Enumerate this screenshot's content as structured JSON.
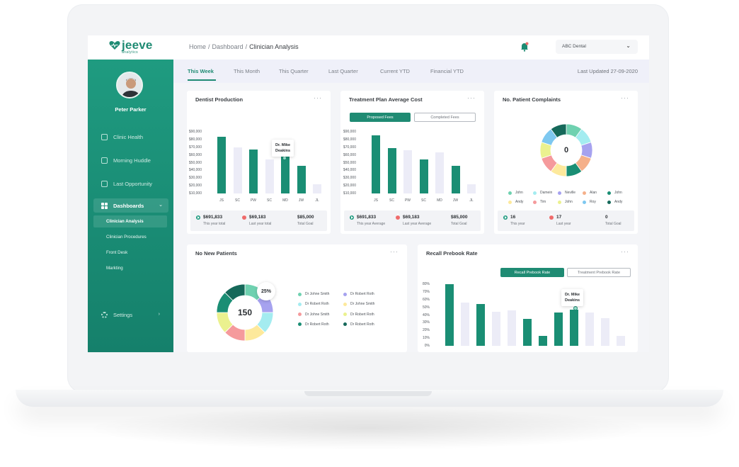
{
  "header": {
    "logo_text": "jeeve",
    "logo_sub": "analytics",
    "breadcrumb": [
      "Home",
      "/",
      "Dashboard",
      "/",
      "Clinician Analysis"
    ],
    "clinic": "ABC Dental"
  },
  "sidebar": {
    "user": "Peter Parker",
    "items": [
      {
        "label": "Clinic Health"
      },
      {
        "label": "Morning Huddle"
      },
      {
        "label": "Last Opportunity"
      }
    ],
    "dashboards_label": "Dashboards",
    "sub_items": [
      {
        "label": "Clinician Analysis"
      },
      {
        "label": "Clinician Procedures"
      },
      {
        "label": "Front Desk"
      },
      {
        "label": "Markting"
      }
    ],
    "settings_label": "Settings"
  },
  "tabs": [
    "This Week",
    "This Month",
    "This Quarter",
    "Last Quarter",
    "Current YTD",
    "Financial YTD"
  ],
  "last_updated": "Last Updated 27-09-2020",
  "colors": {
    "accent": "#1f8b73",
    "bar_primary": "#1a8e74",
    "bar_secondary": "#ececf7"
  },
  "cards": {
    "dentist_production": {
      "title": "Dentist Production",
      "more": "···",
      "tooltip": [
        "Dr. Mike",
        "Deakins"
      ],
      "stats": [
        {
          "value": "$691,833",
          "label": "This year total",
          "trend": "up"
        },
        {
          "value": "$69,183",
          "label": "Last year total",
          "trend": "down"
        },
        {
          "value": "$85,000",
          "label": "Total Goal",
          "trend": "none"
        }
      ]
    },
    "treatment_plan": {
      "title": "Treatment Plan Average Cost",
      "more": "···",
      "btn_active": "Proposed Fees",
      "btn_inactive": "Completed Fees",
      "stats": [
        {
          "value": "$691,833",
          "label": "This year Average",
          "trend": "up"
        },
        {
          "value": "$69,183",
          "label": "Last year Average",
          "trend": "down"
        },
        {
          "value": "$85,000",
          "label": "Total Goal",
          "trend": "none"
        }
      ]
    },
    "complaints": {
      "title": "No. Patient Complaints",
      "more": "···",
      "center": "0",
      "stats": [
        {
          "value": "16",
          "label": "This year",
          "trend": "up"
        },
        {
          "value": "17",
          "label": "Last year",
          "trend": "down"
        },
        {
          "value": "0",
          "label": "Total Goal",
          "trend": "none"
        }
      ]
    },
    "new_patients": {
      "title": "No New Patients",
      "more": "···",
      "center": "150",
      "badge": "25%"
    },
    "recall": {
      "title": "Recall Prebook Rate",
      "more": "···",
      "btn_active": "Recall Prebook Rate",
      "btn_inactive": "Treatment Prebook Rate",
      "tooltip": [
        "Dr. Mike",
        "Deakins"
      ]
    }
  },
  "chart_data": [
    {
      "type": "bar",
      "title": "Dentist Production",
      "categories": [
        "JS",
        "SC",
        "PW",
        "SC",
        "MD",
        "JW",
        "JL"
      ],
      "y_ticks": [
        "$90,000",
        "$80,000",
        "$70,000",
        "$60,000",
        "$50,000",
        "$40,000",
        "$30,000",
        "$20,000",
        "$10,000"
      ],
      "ylim": [
        10000,
        90000
      ],
      "values": [
        84000,
        70000,
        67000,
        54000,
        63000,
        46000,
        22000
      ],
      "highlight": [
        true,
        false,
        true,
        false,
        true,
        true,
        false
      ]
    },
    {
      "type": "bar",
      "title": "Treatment Plan Average Cost",
      "categories": [
        "JS",
        "SC",
        "PW",
        "SC",
        "MD",
        "JW",
        "JL"
      ],
      "y_ticks": [
        "$90,000",
        "$80,000",
        "$70,000",
        "$60,000",
        "$50,000",
        "$40,000",
        "$30,000",
        "$20,000",
        "$10,000"
      ],
      "ylim": [
        10000,
        90000
      ],
      "values": [
        85000,
        69000,
        66000,
        54000,
        63000,
        46000,
        22000
      ],
      "highlight": [
        true,
        true,
        false,
        true,
        false,
        true,
        false
      ]
    },
    {
      "type": "pie",
      "title": "No. Patient Complaints",
      "legend": [
        {
          "name": "John",
          "color": "#6fd1b0"
        },
        {
          "name": "Damein",
          "color": "#a4ecf0"
        },
        {
          "name": "Neville",
          "color": "#a6a2ef"
        },
        {
          "name": "Alan",
          "color": "#f5b08a"
        },
        {
          "name": "John",
          "color": "#1a8e74"
        },
        {
          "name": "Andy",
          "color": "#fde99c"
        },
        {
          "name": "Tim",
          "color": "#f59a9c"
        },
        {
          "name": "John",
          "color": "#ebf18f"
        },
        {
          "name": "Roy",
          "color": "#7ec8f0"
        },
        {
          "name": "Andy",
          "color": "#16695a"
        }
      ],
      "values": [
        1,
        1,
        1,
        1,
        1,
        1,
        1,
        1,
        1,
        1
      ]
    },
    {
      "type": "pie",
      "title": "No New Patients",
      "legend": [
        {
          "name": "Dr Johne Smith",
          "color": "#6fd1b0"
        },
        {
          "name": "Dr Robert Roth",
          "color": "#a6a2ef"
        },
        {
          "name": "Dr Robert Roth",
          "color": "#a4ecf0"
        },
        {
          "name": "Dr Johne Smith",
          "color": "#fde99c"
        },
        {
          "name": "Dr Johne Smith",
          "color": "#f59a9c"
        },
        {
          "name": "Dr Robert Roth",
          "color": "#ebf18f"
        },
        {
          "name": "Dr Robert Roth",
          "color": "#1a8e74"
        },
        {
          "name": "Dr Robert Roth",
          "color": "#16695a"
        }
      ],
      "values": [
        1,
        1,
        1,
        1,
        1,
        1,
        1,
        1
      ]
    },
    {
      "type": "bar",
      "title": "Recall Prebook Rate",
      "categories": [
        "",
        "",
        "",
        "",
        "",
        "",
        "",
        "",
        "",
        "",
        "",
        ""
      ],
      "y_ticks": [
        "80%",
        "70%",
        "60%",
        "50%",
        "40%",
        "30%",
        "20%",
        "10%",
        "0%"
      ],
      "ylim": [
        0,
        80
      ],
      "values": [
        80,
        56,
        54,
        44,
        46,
        35,
        13,
        43,
        47,
        43,
        36,
        13
      ],
      "highlight": [
        true,
        false,
        true,
        false,
        false,
        true,
        true,
        true,
        true,
        false,
        false,
        false
      ]
    }
  ]
}
